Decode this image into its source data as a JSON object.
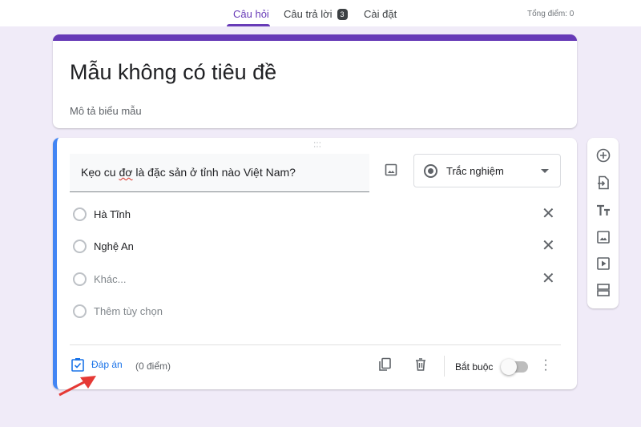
{
  "header": {
    "tabs": [
      {
        "label": "Câu hỏi"
      },
      {
        "label": "Câu trả lời",
        "badge": "3"
      },
      {
        "label": "Cài đặt"
      }
    ],
    "total_points": "Tổng điểm: 0"
  },
  "form": {
    "title": "Mẫu không có tiêu đề",
    "description_placeholder": "Mô tả biểu mẫu"
  },
  "question": {
    "text_before": "Kẹo cu ",
    "text_misspelled": "đơ",
    "text_after": " là đặc sản ở tỉnh nào Việt Nam?",
    "type": "Trắc nghiệm",
    "options": [
      {
        "label": "Hà Tĩnh"
      },
      {
        "label": "Nghệ An"
      },
      {
        "label": "Khác..."
      }
    ],
    "add_option": "Thêm tùy chọn"
  },
  "footer": {
    "answer_key": "Đáp án",
    "points": "(0 điểm)",
    "required_label": "Bắt buộc",
    "required": false
  },
  "colors": {
    "accent": "#673ab7",
    "active_question": "#4285f4",
    "link": "#1a73e8",
    "arrow": "#e53935"
  }
}
